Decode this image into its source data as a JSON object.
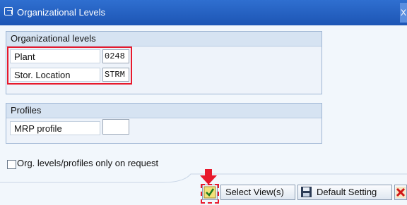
{
  "window": {
    "title": "Organizational Levels",
    "close_label": "X"
  },
  "org_group": {
    "header": "Organizational levels",
    "fields": [
      {
        "label": "Plant",
        "value": "0248"
      },
      {
        "label": "Stor. Location",
        "value": "STRM"
      }
    ]
  },
  "profiles_group": {
    "header": "Profiles",
    "mrp_label": "MRP profile",
    "mrp_value": ""
  },
  "checkbox": {
    "label": "Org. levels/profiles only on request",
    "checked": false
  },
  "buttons": {
    "select_views": "Select View(s)",
    "default_setting": "Default Setting"
  },
  "colors": {
    "highlight": "#e8192c",
    "accent": "#1d55b4"
  },
  "icons": [
    "organizational-levels-icon",
    "checkmark-icon",
    "save-icon",
    "cancel-icon",
    "arrow-down-icon"
  ]
}
